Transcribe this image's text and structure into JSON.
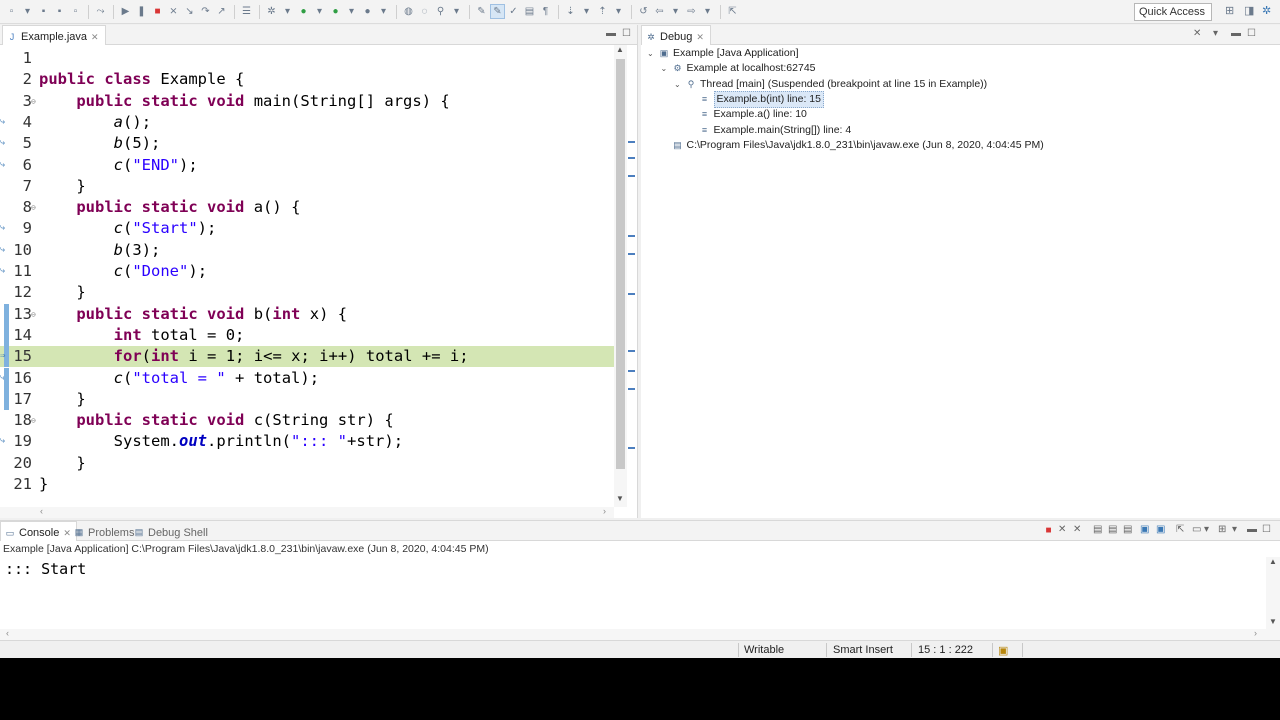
{
  "toolbar": {
    "quick_access": "Quick Access"
  },
  "editor": {
    "tab_label": "Example.java",
    "lines": [
      {
        "n": "1",
        "text": ""
      },
      {
        "n": "2",
        "text": "public class Example {"
      },
      {
        "n": "3",
        "text": "    public static void main(String[] args) {"
      },
      {
        "n": "4",
        "text": "        a();"
      },
      {
        "n": "5",
        "text": "        b(5);"
      },
      {
        "n": "6",
        "text": "        c(\"END\");"
      },
      {
        "n": "7",
        "text": "    }"
      },
      {
        "n": "8",
        "text": "    public static void a() {"
      },
      {
        "n": "9",
        "text": "        c(\"Start\");"
      },
      {
        "n": "10",
        "text": "        b(3);"
      },
      {
        "n": "11",
        "text": "        c(\"Done\");"
      },
      {
        "n": "12",
        "text": "    }"
      },
      {
        "n": "13",
        "text": "    public static void b(int x) {"
      },
      {
        "n": "14",
        "text": "        int total = 0;"
      },
      {
        "n": "15",
        "text": "        for(int i = 1; i<= x; i++) total += i;"
      },
      {
        "n": "16",
        "text": "        c(\"total = \" + total);"
      },
      {
        "n": "17",
        "text": "    }"
      },
      {
        "n": "18",
        "text": "    public static void c(String str) {"
      },
      {
        "n": "19",
        "text": "        System.out.println(\"::: \"+str);"
      },
      {
        "n": "20",
        "text": "    }"
      },
      {
        "n": "21",
        "text": "}"
      }
    ],
    "current_line": 15
  },
  "debug": {
    "tab_label": "Debug",
    "tree": [
      {
        "label": "Example [Java Application]",
        "level": 0,
        "icon": "launch-icon"
      },
      {
        "label": "Example at localhost:62745",
        "level": 1,
        "icon": "vm-icon"
      },
      {
        "label": "Thread [main] (Suspended (breakpoint at line 15 in Example))",
        "level": 2,
        "icon": "thread-icon"
      },
      {
        "label": "Example.b(int) line: 15",
        "level": 3,
        "icon": "frame-icon",
        "selected": true
      },
      {
        "label": "Example.a() line: 10",
        "level": 3,
        "icon": "frame-icon"
      },
      {
        "label": "Example.main(String[]) line: 4",
        "level": 3,
        "icon": "frame-icon"
      },
      {
        "label": "C:\\Program Files\\Java\\jdk1.8.0_231\\bin\\javaw.exe (Jun 8, 2020, 4:04:45 PM)",
        "level": 1,
        "icon": "process-icon"
      }
    ]
  },
  "console": {
    "tabs": [
      "Console",
      "Problems",
      "Debug Shell"
    ],
    "description": "Example [Java Application] C:\\Program Files\\Java\\jdk1.8.0_231\\bin\\javaw.exe (Jun 8, 2020, 4:04:45 PM)",
    "output": "::: Start"
  },
  "status": {
    "writable": "Writable",
    "insert_mode": "Smart Insert",
    "position": "15 : 1 : 222"
  },
  "colors": {
    "current_line_highlight": "#d4e6b4",
    "keyword": "#7f0055",
    "string": "#2a00ff"
  }
}
